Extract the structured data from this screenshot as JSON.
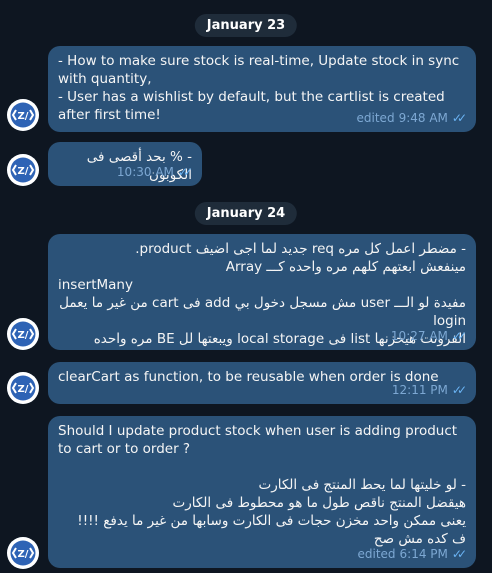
{
  "dates": {
    "d1": "January 23",
    "d2": "January 24"
  },
  "messages": [
    {
      "text": "- How to make sure stock is real-time, Update stock in sync with quantity,\n- User has a wishlist by default, but the cartlist is created after first time!",
      "status": "edited",
      "time": "9:48 AM"
    },
    {
      "text": "- % بحد أقصى فى الكوبون",
      "time": "10:30 AM"
    },
    {
      "text_rtl1": "- مضطر اعمل كل مره req جديد لما اجى اضيف product.\nمينفعش ابعتهم كلهم مره واحده كـــ Array",
      "text_ltr": "insertMany",
      "text_rtl2": "مفيدة لو الـــ user مش مسجل دخول بي add فى cart من غير ما يعمل login\nالفرونت هيخزنها list فى local storage ويبعتها لل BE مره واحده",
      "time": "10:27 AM"
    },
    {
      "text": "clearCart as function, to be reusable when order is done",
      "time": "12:11 PM"
    },
    {
      "text": "Should I update product stock when user is adding product to cart or to order ?",
      "text_rtl": "- لو خليتها لما يحط المنتج فى الكارت\nهيقضل المنتج ناقص طول ما هو محطوط فى الكارت\nيعنى ممكن واحد مخزن حجات فى الكارت وسابها من غير ما يدفع !!!!\nف كده مش صح",
      "status": "edited",
      "time": "6:14 PM"
    }
  ],
  "colors": {
    "background": "#0e1621",
    "bubble": "#2b5278",
    "accent": "#6ab3f3"
  },
  "icons": {
    "avatar": "zl-logo-icon",
    "read": "double-check-icon"
  }
}
